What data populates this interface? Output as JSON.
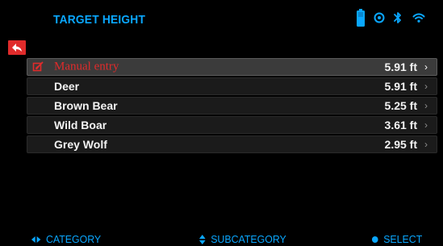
{
  "header": {
    "title": "TARGET HEIGHT"
  },
  "status_icons": [
    {
      "name": "battery-icon"
    },
    {
      "name": "record-icon"
    },
    {
      "name": "bluetooth-icon"
    },
    {
      "name": "wifi-icon"
    }
  ],
  "back": {
    "icon": "back-arrow-icon"
  },
  "list": {
    "rows": [
      {
        "label": "Manual entry",
        "value": "5.91 ft",
        "selected": true
      },
      {
        "label": "Deer",
        "value": "5.91 ft",
        "selected": false
      },
      {
        "label": "Brown Bear",
        "value": "5.25 ft",
        "selected": false
      },
      {
        "label": "Wild Boar",
        "value": "3.61 ft",
        "selected": false
      },
      {
        "label": "Grey Wolf",
        "value": "2.95 ft",
        "selected": false
      }
    ]
  },
  "bottom": {
    "category": "CATEGORY",
    "subcategory": "SUBCATEGORY",
    "select": "SELECT"
  },
  "colors": {
    "accent": "#0aa7ff",
    "danger": "#e02b2b"
  }
}
